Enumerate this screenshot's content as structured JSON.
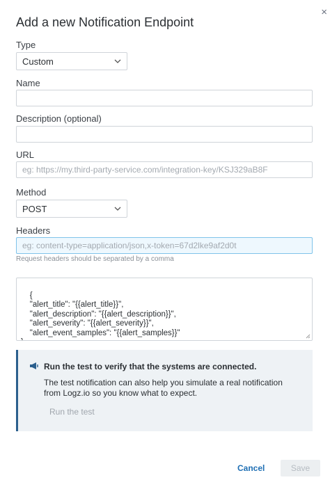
{
  "dialog": {
    "title": "Add a new Notification Endpoint",
    "close_glyph": "×"
  },
  "type": {
    "label": "Type",
    "value": "Custom"
  },
  "name": {
    "label": "Name",
    "value": "",
    "placeholder": ""
  },
  "description": {
    "label": "Description (optional)",
    "value": "",
    "placeholder": ""
  },
  "url": {
    "label": "URL",
    "value": "",
    "placeholder": "eg: https://my.third-party-service.com/integration-key/KSJ329aB8F"
  },
  "method": {
    "label": "Method",
    "value": "POST"
  },
  "headers": {
    "label": "Headers",
    "value": "",
    "placeholder": "eg: content-type=application/json,x-token=67d2lke9af2d0t",
    "hint": "Request headers should be separated by a comma"
  },
  "body": {
    "text": "{\n    \"alert_title\": \"{{alert_title}}\",\n    \"alert_description\": \"{{alert_description}}\",\n    \"alert_severity\": \"{{alert_severity}}\",\n    \"alert_event_samples\": \"{{alert_samples}}\"\n}"
  },
  "info": {
    "icon": "megaphone-icon",
    "heading": "Run the test to verify that the systems are connected.",
    "text": "The test notification can also help you simulate a real notification from Logz.io so you know what to expect.",
    "run_label": "Run the test"
  },
  "footer": {
    "cancel_label": "Cancel",
    "save_label": "Save"
  },
  "colors": {
    "accent": "#1f6fb4",
    "info_bar": "#2b5f8d",
    "info_bg": "#eef2f5",
    "focus_border": "#7fc3ea"
  }
}
